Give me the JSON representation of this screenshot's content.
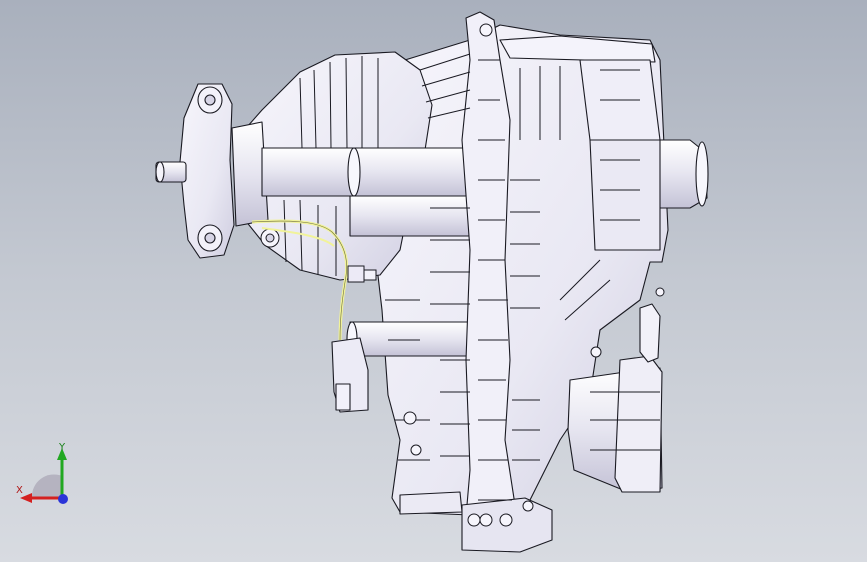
{
  "viewport": {
    "background_top": "#a9b0bd",
    "background_bottom": "#d8dbe1",
    "model": {
      "part": "transfer-case-assembly",
      "shading": "white-with-black-edges",
      "body_color": "#eeedf7",
      "shadow_color": "#bcbad0",
      "wire_color": "#f1f39a"
    },
    "triad": {
      "x_label": "X",
      "y_label": "Y",
      "x_color": "#d42020",
      "y_color": "#21a821",
      "z_color": "#2a34d8"
    }
  }
}
